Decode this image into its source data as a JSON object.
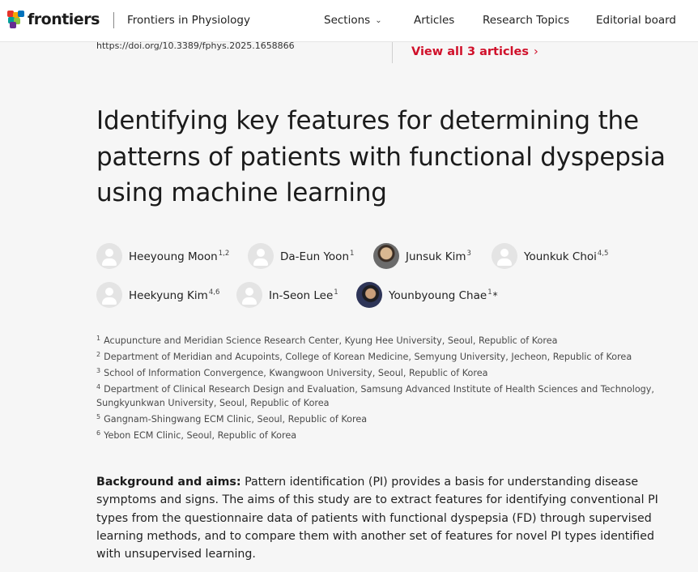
{
  "header": {
    "brand": "frontiers",
    "journal": "Frontiers in Physiology",
    "nav": [
      {
        "label": "Sections",
        "has_dropdown": true
      },
      {
        "label": "Articles",
        "has_dropdown": false
      },
      {
        "label": "Research Topics",
        "has_dropdown": false
      },
      {
        "label": "Editorial board",
        "has_dropdown": false
      }
    ],
    "dropdown_icon": "chevron-down-icon"
  },
  "doi": "https://doi.org/10.3389/fphys.2025.1658866",
  "view_all": {
    "label": "View all 3 articles",
    "icon": "chevron-right-icon",
    "color": "#d0102a"
  },
  "title": "Identifying key features for determining the patterns of patients with functional dyspepsia using machine learning",
  "authors": [
    {
      "name": "Heeyoung Moon",
      "sup": "1,2",
      "avatar": "placeholder",
      "corresponding": false
    },
    {
      "name": "Da-Eun Yoon",
      "sup": "1",
      "avatar": "placeholder",
      "corresponding": false
    },
    {
      "name": "Junsuk Kim",
      "sup": "3",
      "avatar": "photo",
      "corresponding": false
    },
    {
      "name": "Younkuk Choi",
      "sup": "4,5",
      "avatar": "placeholder",
      "corresponding": false
    },
    {
      "name": "Heekyung Kim",
      "sup": "4,6",
      "avatar": "placeholder",
      "corresponding": false
    },
    {
      "name": "In-Seon Lee",
      "sup": "1",
      "avatar": "placeholder",
      "corresponding": false
    },
    {
      "name": "Younbyoung Chae",
      "sup": "1",
      "avatar": "photo",
      "corresponding": true,
      "mark": "*"
    }
  ],
  "affiliations": [
    {
      "num": "1",
      "text": "Acupuncture and Meridian Science Research Center, Kyung Hee University, Seoul, Republic of Korea"
    },
    {
      "num": "2",
      "text": "Department of Meridian and Acupoints, College of Korean Medicine, Semyung University, Jecheon, Republic of Korea"
    },
    {
      "num": "3",
      "text": "School of Information Convergence, Kwangwoon University, Seoul, Republic of Korea"
    },
    {
      "num": "4",
      "text": "Department of Clinical Research Design and Evaluation, Samsung Advanced Institute of Health Sciences and Technology, Sungkyunkwan University, Seoul, Republic of Korea"
    },
    {
      "num": "5",
      "text": "Gangnam-Shingwang ECM Clinic, Seoul, Republic of Korea"
    },
    {
      "num": "6",
      "text": "Yebon ECM Clinic, Seoul, Republic of Korea"
    }
  ],
  "abstract": {
    "heading": "Background and aims:",
    "text": "Pattern identification (PI) provides a basis for understanding disease symptoms and signs. The aims of this study are to extract features for identifying conventional PI types from the questionnaire data of patients with functional dyspepsia (FD) through supervised learning methods, and to compare them with another set of features for novel PI types identified with unsupervised learning."
  },
  "colors": {
    "brand_red": "#d0102a",
    "background": "#f6f6f6",
    "header_bg": "#ffffff"
  }
}
